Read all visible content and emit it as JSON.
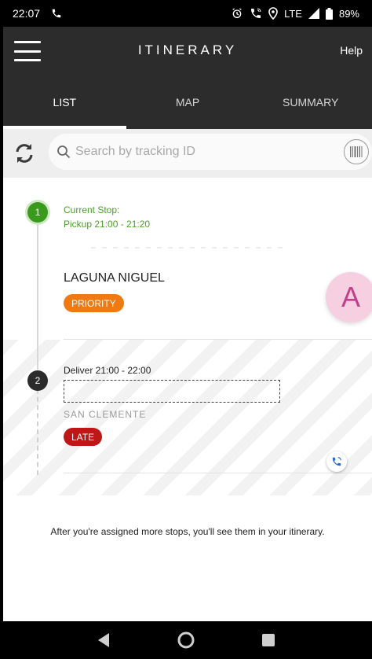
{
  "status_bar": {
    "time": "22:07",
    "network": "LTE",
    "battery": "89%"
  },
  "header": {
    "title": "ITINERARY",
    "help_label": "Help"
  },
  "tabs": [
    {
      "label": "LIST",
      "active": true
    },
    {
      "label": "MAP",
      "active": false
    },
    {
      "label": "SUMMARY",
      "active": false
    }
  ],
  "search": {
    "placeholder": "Search by tracking ID",
    "value": ""
  },
  "stops": [
    {
      "number": "1",
      "status_label": "Current Stop:",
      "time_label": "Pickup 21:00 - 21:20",
      "city": "LAGUNA NIGUEL",
      "badge": "PRIORITY"
    },
    {
      "number": "2",
      "time_label": "Deliver 21:00 - 22:00",
      "city": "SAN CLEMENTE",
      "badge": "LATE"
    }
  ],
  "fab": {
    "letter": "A"
  },
  "empty_message": "After you're assigned more stops, you'll see them in your itinerary.",
  "colors": {
    "header_bg": "#2d2c2c",
    "current_green": "#3a9a1c",
    "priority_orange": "#f07a10",
    "late_red": "#c01616"
  }
}
